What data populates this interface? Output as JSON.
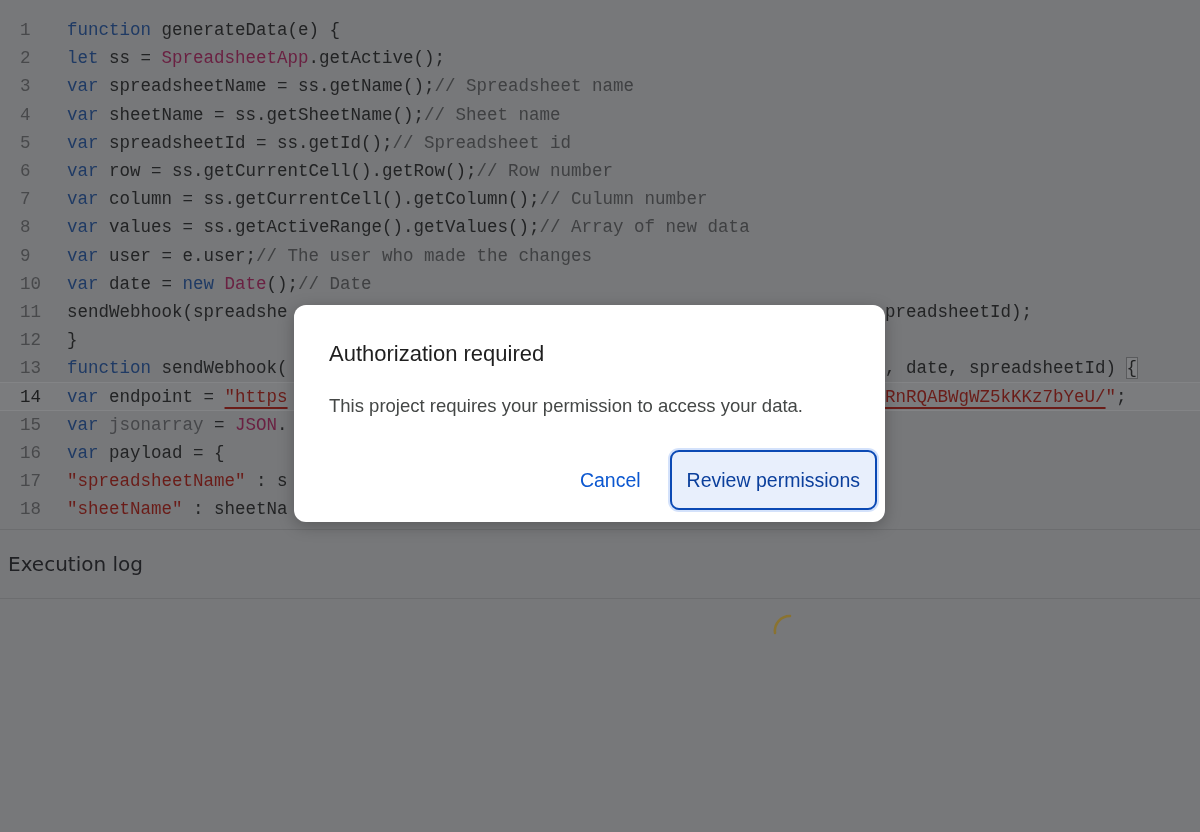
{
  "editor": {
    "lines": [
      {
        "number": "1",
        "current": false,
        "code": [
          {
            "kind": "keyword",
            "text": "function"
          },
          {
            "kind": "plain",
            "text": " generateData(e) {"
          }
        ]
      },
      {
        "number": "2",
        "current": false,
        "code": [
          {
            "kind": "keyword",
            "text": "let"
          },
          {
            "kind": "plain",
            "text": " ss = "
          },
          {
            "kind": "class",
            "text": "SpreadsheetApp"
          },
          {
            "kind": "plain",
            "text": ".getActive();"
          }
        ]
      },
      {
        "number": "3",
        "current": false,
        "code": [
          {
            "kind": "keyword",
            "text": "var"
          },
          {
            "kind": "plain",
            "text": " spreadsheetName = ss.getName();"
          },
          {
            "kind": "comment",
            "text": "// Spreadsheet name"
          }
        ]
      },
      {
        "number": "4",
        "current": false,
        "code": [
          {
            "kind": "keyword",
            "text": "var"
          },
          {
            "kind": "plain",
            "text": " sheetName = ss.getSheetName();"
          },
          {
            "kind": "comment",
            "text": "// Sheet name"
          }
        ]
      },
      {
        "number": "5",
        "current": false,
        "code": [
          {
            "kind": "keyword",
            "text": "var"
          },
          {
            "kind": "plain",
            "text": " spreadsheetId = ss.getId();"
          },
          {
            "kind": "comment",
            "text": "// Spreadsheet id"
          }
        ]
      },
      {
        "number": "6",
        "current": false,
        "code": [
          {
            "kind": "keyword",
            "text": "var"
          },
          {
            "kind": "plain",
            "text": " row = ss.getCurrentCell().getRow();"
          },
          {
            "kind": "comment",
            "text": "// Row number"
          }
        ]
      },
      {
        "number": "7",
        "current": false,
        "code": [
          {
            "kind": "keyword",
            "text": "var"
          },
          {
            "kind": "plain",
            "text": " column = ss.getCurrentCell().getColumn();"
          },
          {
            "kind": "comment",
            "text": "// Culumn number"
          }
        ]
      },
      {
        "number": "8",
        "current": false,
        "code": [
          {
            "kind": "keyword",
            "text": "var"
          },
          {
            "kind": "plain",
            "text": " values = ss.getActiveRange().getValues();"
          },
          {
            "kind": "comment",
            "text": "// Array of new data"
          }
        ]
      },
      {
        "number": "9",
        "current": false,
        "code": [
          {
            "kind": "keyword",
            "text": "var"
          },
          {
            "kind": "plain",
            "text": " user = e.user;"
          },
          {
            "kind": "comment",
            "text": "// The user who made the changes"
          }
        ]
      },
      {
        "number": "10",
        "current": false,
        "code": [
          {
            "kind": "keyword",
            "text": "var"
          },
          {
            "kind": "plain",
            "text": " date = "
          },
          {
            "kind": "keyword",
            "text": "new "
          },
          {
            "kind": "class",
            "text": "Date"
          },
          {
            "kind": "plain",
            "text": "();"
          },
          {
            "kind": "comment",
            "text": "// Date"
          }
        ]
      },
      {
        "number": "11",
        "current": false,
        "code": [
          {
            "kind": "plain",
            "text": "sendWebhook(spreadshe"
          }
        ],
        "after_dialog": [
          {
            "kind": "plain",
            "text": "preadsheetId);"
          }
        ]
      },
      {
        "number": "12",
        "current": false,
        "code": [
          {
            "kind": "plain",
            "text": "}"
          }
        ]
      },
      {
        "number": "13",
        "current": false,
        "code": [
          {
            "kind": "keyword",
            "text": "function"
          },
          {
            "kind": "plain",
            "text": " sendWebhook("
          }
        ],
        "after_dialog": [
          {
            "kind": "plain",
            "text": ", date, spreadsheetId) "
          },
          {
            "kind": "bracket",
            "text": "{"
          }
        ]
      },
      {
        "number": "14",
        "current": true,
        "code": [
          {
            "kind": "keyword",
            "text": "var"
          },
          {
            "kind": "plain",
            "text": " endpoint = "
          },
          {
            "kind": "url",
            "text": "\"https"
          }
        ],
        "after_dialog": [
          {
            "kind": "url",
            "text": "RnRQABWgWZ5kKKz7bYeU/"
          },
          {
            "kind": "string",
            "text": "\""
          },
          {
            "kind": "plain",
            "text": ";"
          }
        ]
      },
      {
        "number": "15",
        "current": false,
        "code": [
          {
            "kind": "keyword",
            "text": "var"
          },
          {
            "kind": "unused",
            "text": " jsonarray"
          },
          {
            "kind": "plain",
            "text": " = "
          },
          {
            "kind": "class",
            "text": "JSON"
          },
          {
            "kind": "plain",
            "text": "."
          }
        ]
      },
      {
        "number": "16",
        "current": false,
        "code": [
          {
            "kind": "keyword",
            "text": "var"
          },
          {
            "kind": "plain",
            "text": " payload = {"
          }
        ]
      },
      {
        "number": "17",
        "current": false,
        "code": [
          {
            "kind": "string",
            "text": "\"spreadsheetName\""
          },
          {
            "kind": "plain",
            "text": " : s"
          }
        ]
      },
      {
        "number": "18",
        "current": false,
        "code": [
          {
            "kind": "string",
            "text": "\"sheetName\""
          },
          {
            "kind": "plain",
            "text": " : sheetNa"
          }
        ]
      }
    ]
  },
  "execution_log": {
    "title": "Execution log",
    "loading": true
  },
  "dialog": {
    "title": "Authorization required",
    "message": "This project requires your permission to access your data.",
    "buttons": [
      {
        "label": "Cancel",
        "kind": "text"
      },
      {
        "label": "Review permissions",
        "kind": "primary"
      }
    ]
  }
}
